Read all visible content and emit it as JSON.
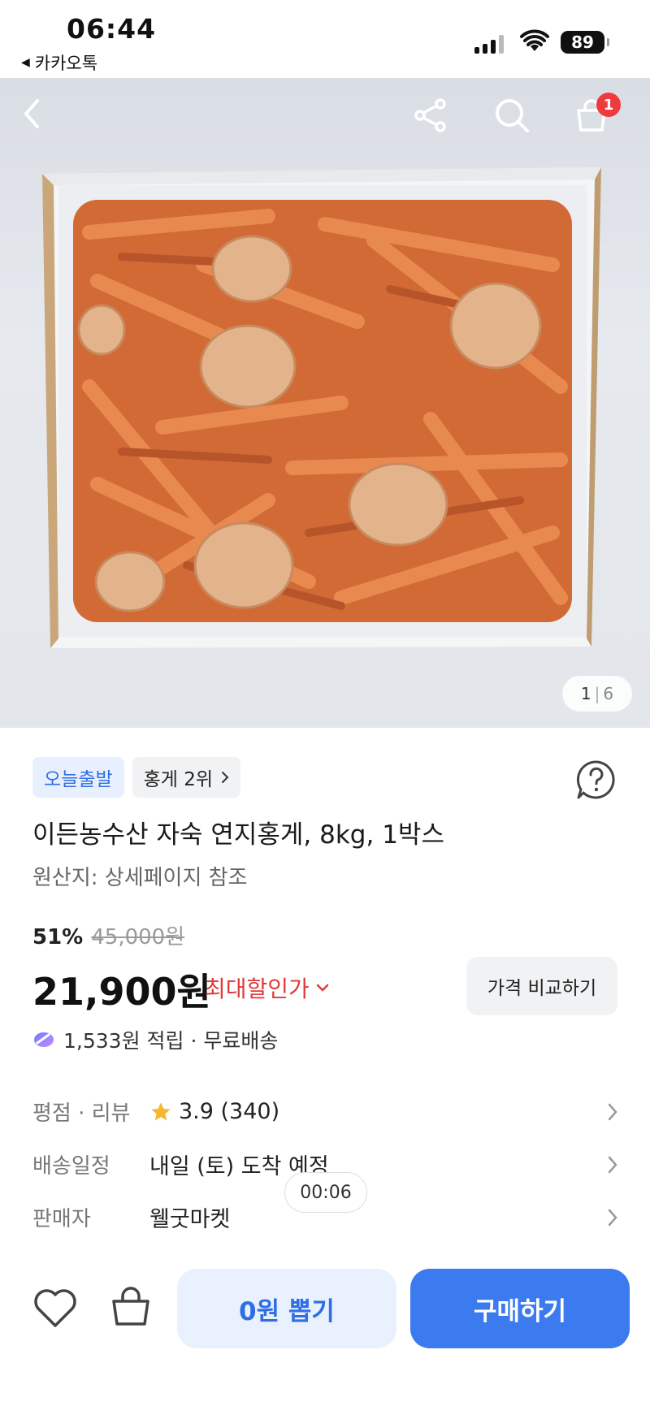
{
  "status_bar": {
    "time": "06:44",
    "back_app": "카카오톡",
    "battery": "89"
  },
  "hero": {
    "page_current": "1",
    "page_total": "6",
    "cart_count": "1",
    "icons": [
      "back-icon",
      "share-icon",
      "search-icon",
      "cart-icon"
    ]
  },
  "product": {
    "badge_today": "오늘출발",
    "badge_rank": "홍게 2위",
    "title": "이든농수산 자숙 연지홍게, 8kg, 1박스",
    "origin": "원산지: 상세페이지 참조",
    "discount_rate": "51%",
    "original_price": "45,000원",
    "price": "21,900원",
    "max_discount": "최대할인가",
    "compare_label": "가격 비교하기",
    "points": "1,533원 적립 · 무료배송"
  },
  "info_rows": [
    {
      "label": "평점 · 리뷰",
      "value": "3.9 (340)"
    },
    {
      "label": "배송일정",
      "value": "내일 (토) 도착 예정"
    },
    {
      "label": "판매자",
      "value": "웰굿마켓"
    }
  ],
  "timer": "00:06",
  "bottom": {
    "draw_label": "0원 뽑기",
    "buy_label": "구매하기"
  },
  "colors": {
    "accent": "#3b7bef",
    "discount_red": "#e03a3a",
    "badge_red": "#ef3b3b"
  }
}
